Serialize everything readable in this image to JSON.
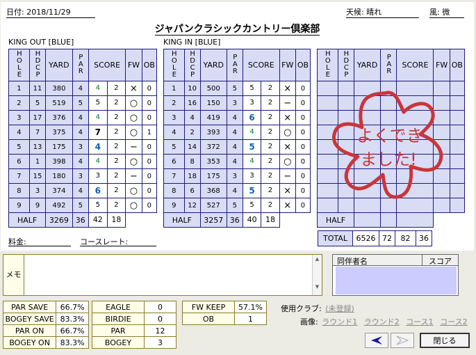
{
  "header": {
    "date_label": "日付: 2018/11/29",
    "weather_label": "天候: 晴れ",
    "wind_label": "風: 微",
    "course_name": "ジャパンクラシックカントリー倶楽部"
  },
  "columns": {
    "hole": "HOLE",
    "hdcp": "HDCP",
    "yard": "YARD",
    "par": "PAR",
    "score": "SCORE",
    "fw": "FW",
    "ob": "OB"
  },
  "out": {
    "label": "KING OUT [BLUE]",
    "rows": [
      {
        "hole": "1",
        "hdcp": "11",
        "yard": "380",
        "par": "4",
        "score": "4",
        "putt": "2",
        "fw": "×",
        "ob": "0",
        "style": "green"
      },
      {
        "hole": "2",
        "hdcp": "5",
        "yard": "519",
        "par": "5",
        "score": "5",
        "putt": "2",
        "fw": "○",
        "ob": "0",
        "style": ""
      },
      {
        "hole": "3",
        "hdcp": "17",
        "yard": "376",
        "par": "4",
        "score": "4",
        "putt": "2",
        "fw": "○",
        "ob": "0",
        "style": "green"
      },
      {
        "hole": "4",
        "hdcp": "7",
        "yard": "375",
        "par": "4",
        "score": "7",
        "putt": "2",
        "fw": "○",
        "ob": "1",
        "style": "bold"
      },
      {
        "hole": "5",
        "hdcp": "13",
        "yard": "175",
        "par": "3",
        "score": "4",
        "putt": "2",
        "fw": "−",
        "ob": "0",
        "style": "blue"
      },
      {
        "hole": "6",
        "hdcp": "1",
        "yard": "398",
        "par": "4",
        "score": "4",
        "putt": "2",
        "fw": "○",
        "ob": "0",
        "style": "green"
      },
      {
        "hole": "7",
        "hdcp": "15",
        "yard": "180",
        "par": "3",
        "score": "3",
        "putt": "2",
        "fw": "−",
        "ob": "0",
        "style": ""
      },
      {
        "hole": "8",
        "hdcp": "3",
        "yard": "374",
        "par": "4",
        "score": "6",
        "putt": "2",
        "fw": "○",
        "ob": "0",
        "style": "blue"
      },
      {
        "hole": "9",
        "hdcp": "9",
        "yard": "492",
        "par": "5",
        "score": "5",
        "putt": "2",
        "fw": "○",
        "ob": "0",
        "style": ""
      }
    ],
    "half": {
      "label": "HALF",
      "yard": "3269",
      "par": "36",
      "score": "42",
      "putt": "18"
    }
  },
  "in": {
    "label": "KING IN [BLUE]",
    "rows": [
      {
        "hole": "1",
        "hdcp": "10",
        "yard": "500",
        "par": "5",
        "score": "5",
        "putt": "2",
        "fw": "×",
        "ob": "0",
        "style": ""
      },
      {
        "hole": "2",
        "hdcp": "16",
        "yard": "150",
        "par": "3",
        "score": "3",
        "putt": "2",
        "fw": "−",
        "ob": "0",
        "style": ""
      },
      {
        "hole": "3",
        "hdcp": "4",
        "yard": "419",
        "par": "4",
        "score": "6",
        "putt": "2",
        "fw": "×",
        "ob": "0",
        "style": "blue"
      },
      {
        "hole": "4",
        "hdcp": "2",
        "yard": "393",
        "par": "4",
        "score": "4",
        "putt": "2",
        "fw": "○",
        "ob": "0",
        "style": "green"
      },
      {
        "hole": "5",
        "hdcp": "14",
        "yard": "372",
        "par": "4",
        "score": "5",
        "putt": "2",
        "fw": "×",
        "ob": "0",
        "style": "blue"
      },
      {
        "hole": "6",
        "hdcp": "8",
        "yard": "353",
        "par": "4",
        "score": "4",
        "putt": "2",
        "fw": "○",
        "ob": "0",
        "style": "green"
      },
      {
        "hole": "7",
        "hdcp": "18",
        "yard": "175",
        "par": "3",
        "score": "3",
        "putt": "2",
        "fw": "−",
        "ob": "0",
        "style": ""
      },
      {
        "hole": "8",
        "hdcp": "6",
        "yard": "368",
        "par": "4",
        "score": "5",
        "putt": "2",
        "fw": "×",
        "ob": "0",
        "style": "blue"
      },
      {
        "hole": "9",
        "hdcp": "12",
        "yard": "527",
        "par": "5",
        "score": "5",
        "putt": "2",
        "fw": "×",
        "ob": "0",
        "style": ""
      }
    ],
    "half": {
      "label": "HALF",
      "yard": "3257",
      "par": "36",
      "score": "40",
      "putt": "18"
    }
  },
  "third": {
    "half_label": "HALF"
  },
  "stamp": {
    "line1": "よくでき",
    "line2": "ました!",
    "color": "#c8363c"
  },
  "total": {
    "label": "TOTAL",
    "yard": "6526",
    "par": "72",
    "score": "82",
    "putt": "36"
  },
  "fee": {
    "fee_label": "料金:",
    "rate_label": "コースレート:"
  },
  "memo": {
    "label": "メモ"
  },
  "companions": {
    "name_header": "同伴者名",
    "score_header": "スコア"
  },
  "stats1": [
    {
      "label": "PAR SAVE",
      "value": "66.7%"
    },
    {
      "label": "BOGEY SAVE",
      "value": "83.3%"
    },
    {
      "label": "PAR ON",
      "value": "66.7%"
    },
    {
      "label": "BOGEY ON",
      "value": "83.3%"
    }
  ],
  "stats2": [
    {
      "label": "EAGLE",
      "value": "0"
    },
    {
      "label": "BIRDIE",
      "value": "0"
    },
    {
      "label": "PAR",
      "value": "12"
    },
    {
      "label": "BOGEY",
      "value": "3"
    }
  ],
  "stats3": [
    {
      "label": "FW KEEP",
      "value": "57.1%"
    },
    {
      "label": "OB",
      "value": "1"
    }
  ],
  "club": {
    "label": "使用クラブ:",
    "value": "(未登録)",
    "image_label": "画像:",
    "round1": "ラウンド1",
    "round2": "ラウンド2",
    "course1": "コース1",
    "course2": "コース2"
  },
  "buttons": {
    "close": "閉じる"
  }
}
